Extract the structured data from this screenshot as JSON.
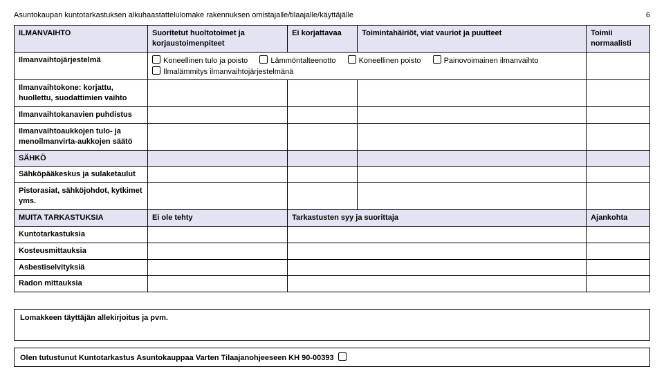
{
  "page": {
    "title": "Asuntokaupan kuntotarkastuksen alkuhaastattelulomake rakennuksen omistajalle/tilaajalle/käyttäjälle",
    "number": "6"
  },
  "sections": {
    "ilmanvaihto": {
      "heading": "ILMANVAIHTO",
      "col_b": "Suoritetut huoltotoimet ja korjaustoimenpiteet",
      "col_c": "Ei korjattavaa",
      "col_d": "Toimintahäiriöt, viat vauriot ja puutteet",
      "col_e": "Toimii normaalisti",
      "rows": {
        "jarjestelma": {
          "label": "Ilmanvaihtojärjestelmä",
          "opts": {
            "a": "Koneellinen tulo ja poisto",
            "b": "Lämmöntalteenotto",
            "c": "Koneellinen poisto",
            "d": "Painovoimainen ilmanvaihto",
            "e": "Ilmalämmitys ilmanvaihtojärjestelmänä"
          }
        },
        "kone": {
          "label": "Ilmanvaihtokone: korjattu, huollettu, suodattimien vaihto"
        },
        "kanavat": {
          "label": "Ilmanvaihtokanavien puhdistus"
        },
        "aukot": {
          "label": "Ilmanvaihtoaukkojen tulo- ja menoilmanvirta-aukkojen säätö"
        }
      }
    },
    "sahko": {
      "heading": "SÄHKÖ",
      "rows": {
        "paakeskus": {
          "label": "Sähköpääkeskus ja sulaketaulut"
        },
        "pistorasiat": {
          "label": "Pistorasiat, sähköjohdot, kytkimet yms."
        }
      }
    },
    "muita": {
      "heading": "MUITA TARKASTUKSIA",
      "col_b": "Ei ole tehty",
      "col_c": "Tarkastusten syy ja suorittaja",
      "col_e": "Ajankohta",
      "rows": {
        "kunto": {
          "label": "Kuntotarkastuksia"
        },
        "kosteus": {
          "label": "Kosteusmittauksia"
        },
        "asbesti": {
          "label": "Asbestiselvityksiä"
        },
        "radon": {
          "label": "Radon mittauksia"
        }
      }
    }
  },
  "signature": {
    "label": "Lomakkeen täyttäjän allekirjoitus ja pvm."
  },
  "ack": {
    "text": "Olen tutustunut Kuntotarkastus Asuntokauppaa Varten Tilaajanohjeeseen KH 90-00393"
  }
}
